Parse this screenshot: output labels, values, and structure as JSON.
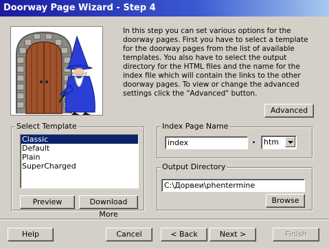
{
  "window": {
    "title": "Doorway Page Wizard - Step 4"
  },
  "intro": {
    "text": "In this step you can  set various options for the doorway pages.  First you have to select a template for the doorway pages from the list of available templates. You also have to select the output directory for the HTML files and the name for the index file which will contain the links to the other doorway pages. To view or change the advanced settings  click the \"Advanced\" button."
  },
  "advanced_label": "Advanced",
  "select_template": {
    "label": "Select Template",
    "items": [
      "Classic",
      "Default",
      "Plain",
      "SuperCharged"
    ],
    "selected": "Classic",
    "preview_label": "Preview",
    "download_label": "Download More"
  },
  "index_page": {
    "label": "Index Page Name",
    "name_value": "index",
    "dot": ".",
    "extension_value": "htm"
  },
  "output_dir": {
    "label": "Output Directory",
    "path_value": "C:\\Дорвеи\\phentermine",
    "browse_label": "Browse"
  },
  "footer": {
    "help_label": "Help",
    "cancel_label": "Cancel",
    "back_label": "< Back",
    "next_label": "Next >",
    "finish_label": "Finish"
  },
  "colors": {
    "dialog_bg": "#d4d0c8",
    "titlebar_start": "#1a1aa0",
    "titlebar_end": "#a6caf0",
    "selection": "#0a246a",
    "wizard_robe": "#2b3fd6"
  },
  "banner_icon": "wizard-at-castle-door-illustration"
}
